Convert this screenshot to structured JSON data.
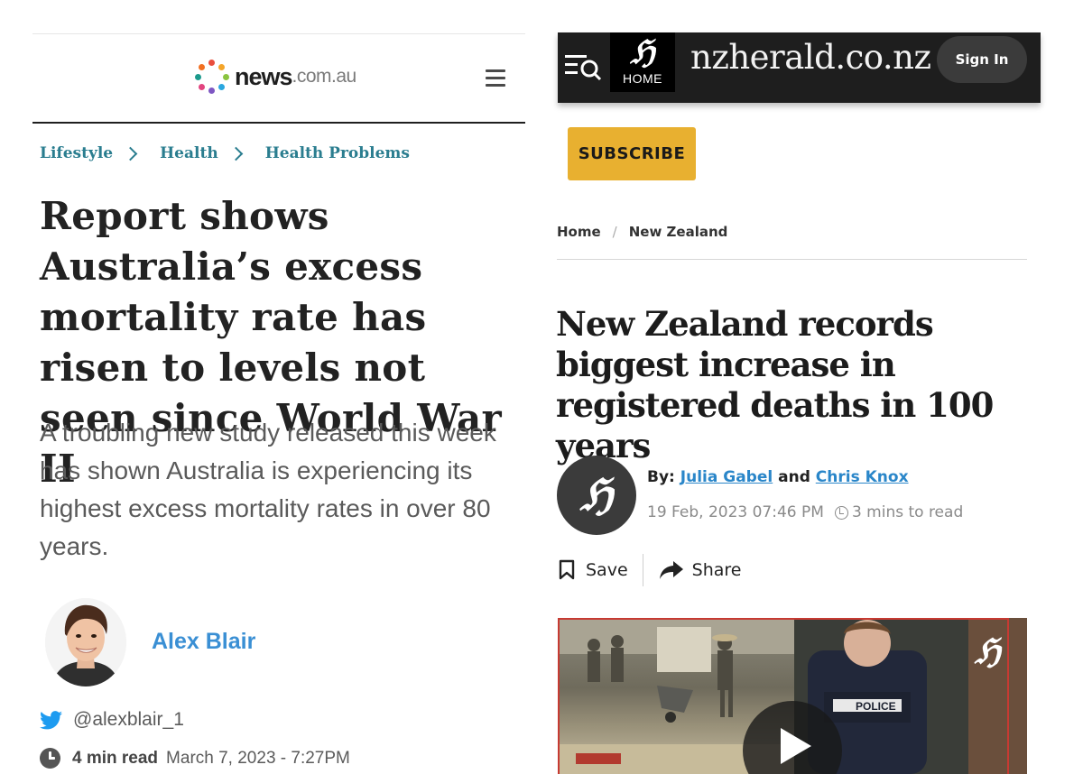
{
  "left": {
    "site": {
      "logo_word": "news",
      "logo_suffix": ".com.au",
      "logo_dot_colors": [
        "#e94e3d",
        "#f4a52a",
        "#8bc43f",
        "#2aa7df",
        "#7e57c2",
        "#e2457f",
        "#1c9a8c",
        "#f27022"
      ]
    },
    "breadcrumb": [
      "Lifestyle",
      "Health",
      "Health Problems"
    ],
    "headline": "Report shows Australia’s excess mortality rate has risen to levels not seen since World War II",
    "standfirst": "A troubling new study released this week has shown Australia is experiencing its highest excess mortality rates in over 80 years.",
    "author": {
      "name": "Alex Blair",
      "twitter": "@alexblair_1"
    },
    "meta": {
      "read_time": "4 min read",
      "date": "March 7, 2023 - 7:27PM"
    },
    "colors": {
      "link": "#2a7d8f",
      "author": "#3a8fd4"
    }
  },
  "right": {
    "site": {
      "home_label": "HOME",
      "brand": "nzherald.co.nz",
      "sign_in": "Sign In",
      "subscribe": "SUBSCRIBE"
    },
    "breadcrumb": [
      "Home",
      "New Zealand"
    ],
    "headline": "New Zealand records biggest increase in registered deaths in 100 years",
    "byline": {
      "prefix": "By:",
      "author_1": "Julia Gabel",
      "conjunction": "and",
      "author_2": "Chris Knox",
      "date": "19 Feb, 2023 07:46 PM",
      "read_time": "3 mins to read"
    },
    "actions": {
      "save": "Save",
      "share": "Share"
    },
    "media": {
      "police_label": "POLICE"
    },
    "colors": {
      "subscribe": "#e8b030",
      "link": "#2a86c9",
      "bar": "#1e1e1e"
    }
  }
}
